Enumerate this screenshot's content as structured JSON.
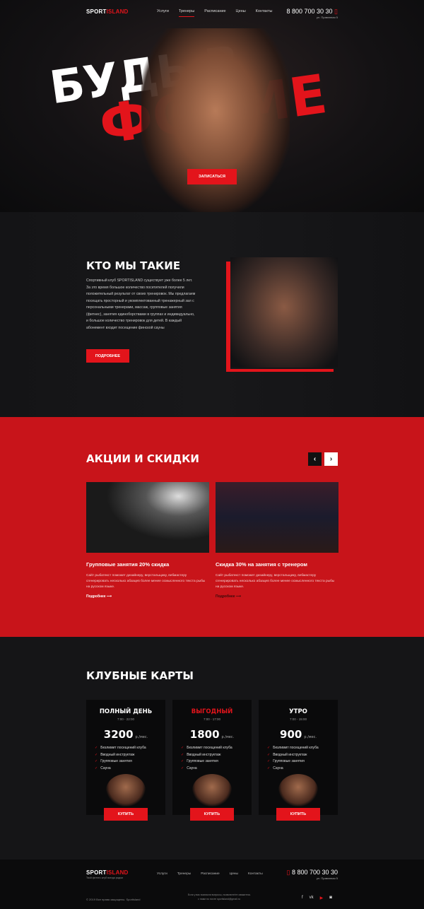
{
  "header": {
    "logo_a": "SPORT",
    "logo_b": "ISLAND",
    "nav": [
      "Услуги",
      "Тренеры",
      "Расписание",
      "Цены",
      "Контакты"
    ],
    "active": 1,
    "phone": "8 800 700 30 30",
    "address": "ул. Правэнная 5"
  },
  "hero": {
    "line1": "БУДЬ В",
    "line2": "ФОРМЕ",
    "cta": "ЗАПИСАТЬСЯ"
  },
  "about": {
    "title": "КТО МЫ ТАКИЕ",
    "text": "Спортивный клуб SPORTISLAND существует уже более 5 лет. За это время большое количество посетителей получили положительный результат от своих тренировок. Мы предлагаем посещать просторный и укомплектованный тренажерный зал с персональными тренерами, массаж, групповые занятия (фитнес), занятия единоборствами в группах и индивидуально, и большое количество тренировок для детей. В каждый абонемент входит посещение финской сауны",
    "button": "ПОДРОБНЕЕ"
  },
  "promo": {
    "title": "АКЦИИ И СКИДКИ",
    "prev": "‹",
    "next": "›",
    "items": [
      {
        "title": "Групповые занятия 20% скидка",
        "text": "Сайт рыбатекст поможет дизайнеру, верстальщику, вебмастеру сгенерировать несколько абзацев более менее осмысленного текста рыбы на русском языке.",
        "more": "Подробнее ⟶"
      },
      {
        "title": "Скидка 30% на занятия с тренером",
        "text": "Сайт рыбатекст поможет дизайнеру, верстальщику, вебмастеру сгенерировать несколько абзацев более менее осмысленного текста рыбы на русском языке.",
        "more": "Подробнее ⟶"
      }
    ]
  },
  "cards": {
    "title": "КЛУБНЫЕ КАРТЫ",
    "unit": "р./мес.",
    "buy": "КУПИТЬ",
    "features": [
      "Безлимит посещений клуба",
      "Вводный инструктаж",
      "Групповые занятия",
      "Сауна"
    ],
    "items": [
      {
        "name": "ПОЛНЫЙ ДЕНЬ",
        "time": "7:00 - 22:00",
        "price": "3200"
      },
      {
        "name": "ВЫГОДНЫЙ",
        "time": "7:00 - 17:00",
        "price": "1800"
      },
      {
        "name": "УТРО",
        "time": "7:00 - 15:00",
        "price": "900"
      }
    ]
  },
  "footer": {
    "tagline": "Твой фитнес клуб всегда рядом",
    "copyright": "© 2019 Все права защищены. Sportisland",
    "q1": "Если у вас возникли вопросы, позвоните/те свяжитесь",
    "q2": "с нами по почте sportisland@gmail.ru",
    "social": [
      "f",
      "vk",
      "▶",
      "◙"
    ]
  },
  "colors": {
    "accent": "#e3141b"
  }
}
